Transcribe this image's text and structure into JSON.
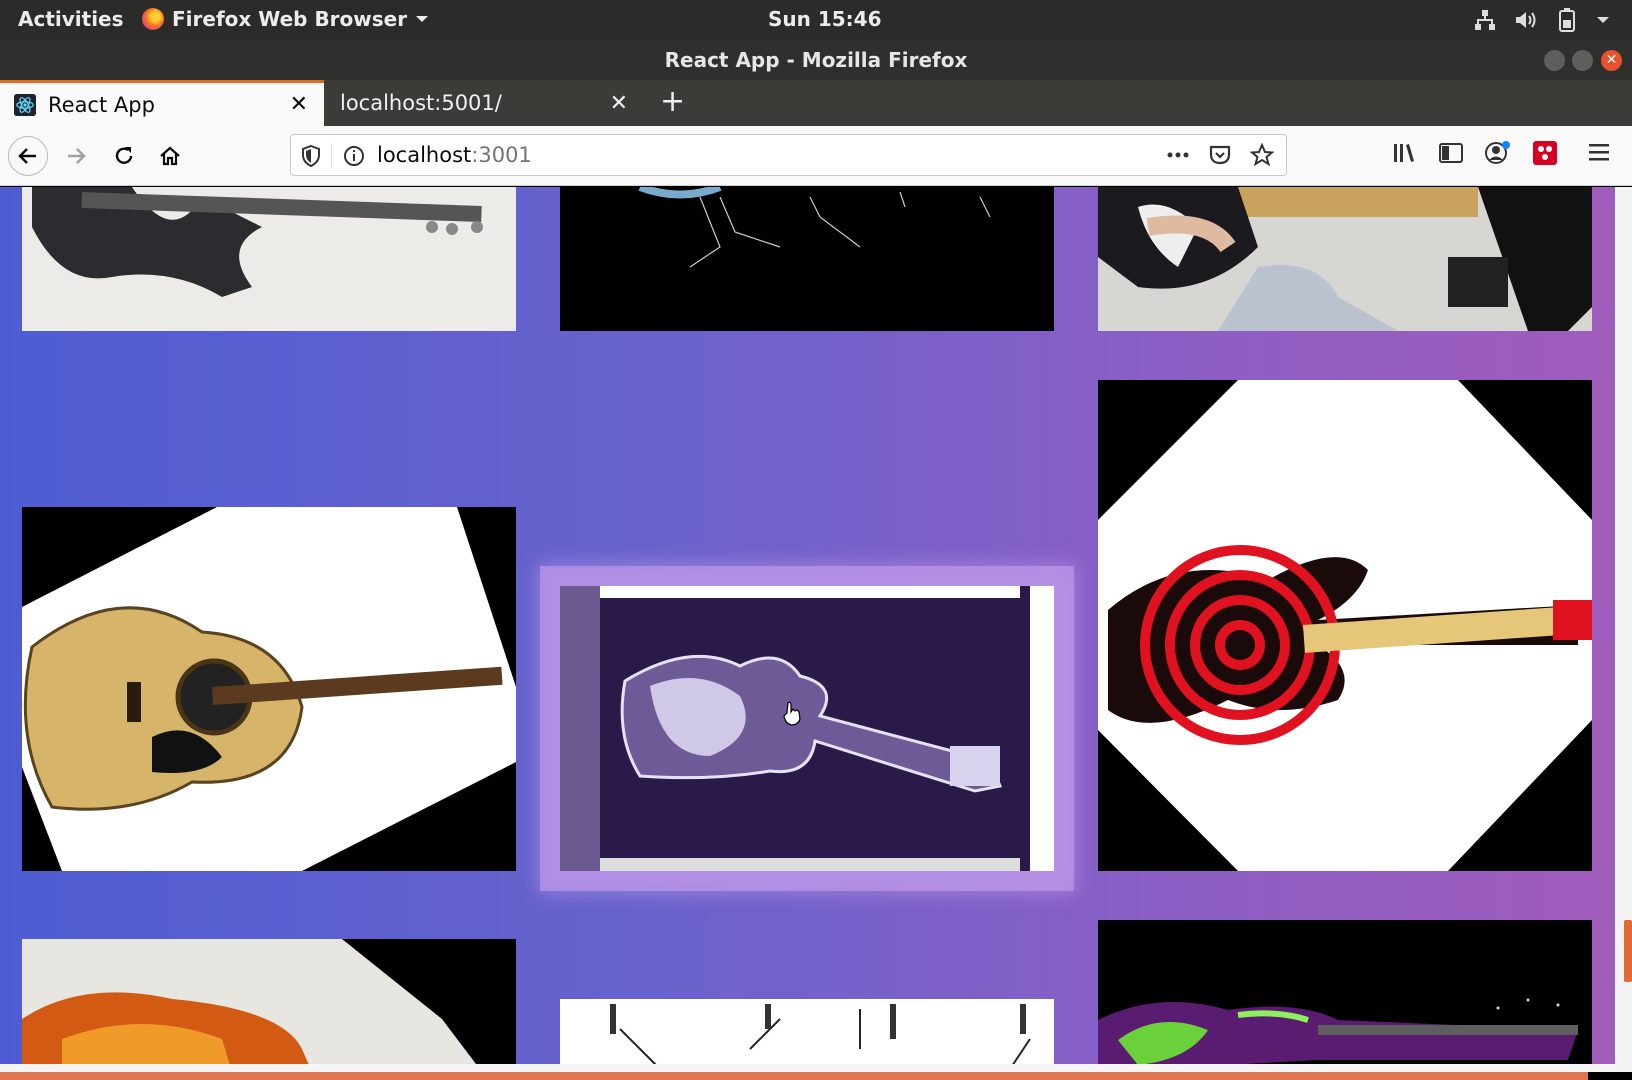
{
  "system_bar": {
    "activities": "Activities",
    "app_menu": "Firefox Web Browser",
    "clock": "Sun 15:46"
  },
  "window": {
    "title": "React App - Mozilla Firefox"
  },
  "tabs": [
    {
      "label": "React App",
      "active": true
    },
    {
      "label": "localhost:5001/",
      "active": false
    }
  ],
  "navbar": {
    "url_host": "localhost",
    "url_port": ":3001"
  },
  "gallery": {
    "items": [
      {
        "name": "electric-bass-photo"
      },
      {
        "name": "guitar-parts-diagram"
      },
      {
        "name": "person-playing-guitar-photo"
      },
      {
        "name": "acoustic-guitar-photo"
      },
      {
        "name": "x-ray-guitar-photo"
      },
      {
        "name": "bullseye-guitar-photo"
      },
      {
        "name": "sunburst-acoustic-photo"
      },
      {
        "name": "tuning-diagram"
      },
      {
        "name": "neon-guitar-photo"
      }
    ]
  },
  "colors": {
    "gradient_start": "#4e5cd2",
    "gradient_end": "#a15cbc",
    "accent": "#e66a1d"
  }
}
